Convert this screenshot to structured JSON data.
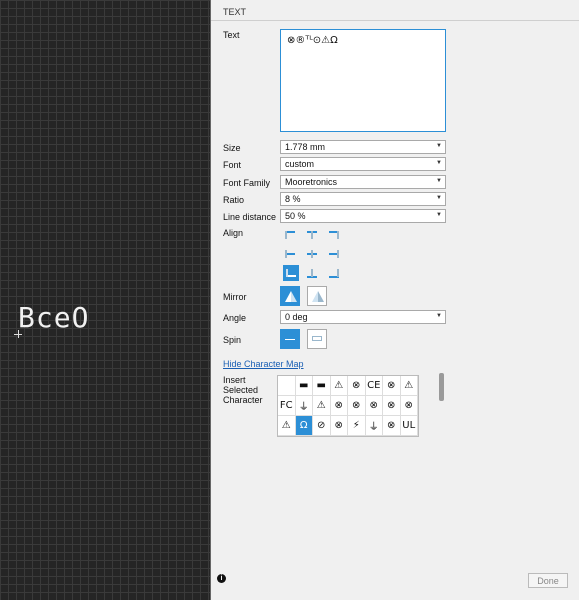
{
  "canvas": {
    "text": "BceO"
  },
  "panel": {
    "title": "TEXT",
    "text_label": "Text",
    "text_value": "⊗®ᵀᴸ⊙⚠Ω",
    "size_label": "Size",
    "size_value": "1.778 mm",
    "font_label": "Font",
    "font_value": "custom",
    "family_label": "Font Family",
    "family_value": "Mooretronics",
    "ratio_label": "Ratio",
    "ratio_value": "8 %",
    "line_label": "Line distance",
    "line_value": "50 %",
    "align_label": "Align",
    "mirror_label": "Mirror",
    "angle_label": "Angle",
    "angle_value": "0 deg",
    "spin_label": "Spin",
    "charmap_link": "Hide Character Map",
    "insert_label": "Insert Selected Character",
    "charmap": [
      "",
      "▬",
      "▬",
      "⚠",
      "⊗",
      "CE",
      "⊗",
      "⚠",
      "FC",
      "⏚",
      "⚠",
      "⊗",
      "⊗",
      "⊗",
      "⊗",
      "⊗",
      "⚠",
      "Ω",
      "⊘",
      "⊗",
      "⚡",
      "⏚",
      "⊗",
      "UL"
    ],
    "done_label": "Done",
    "accent_color": "#2c8fd6"
  }
}
